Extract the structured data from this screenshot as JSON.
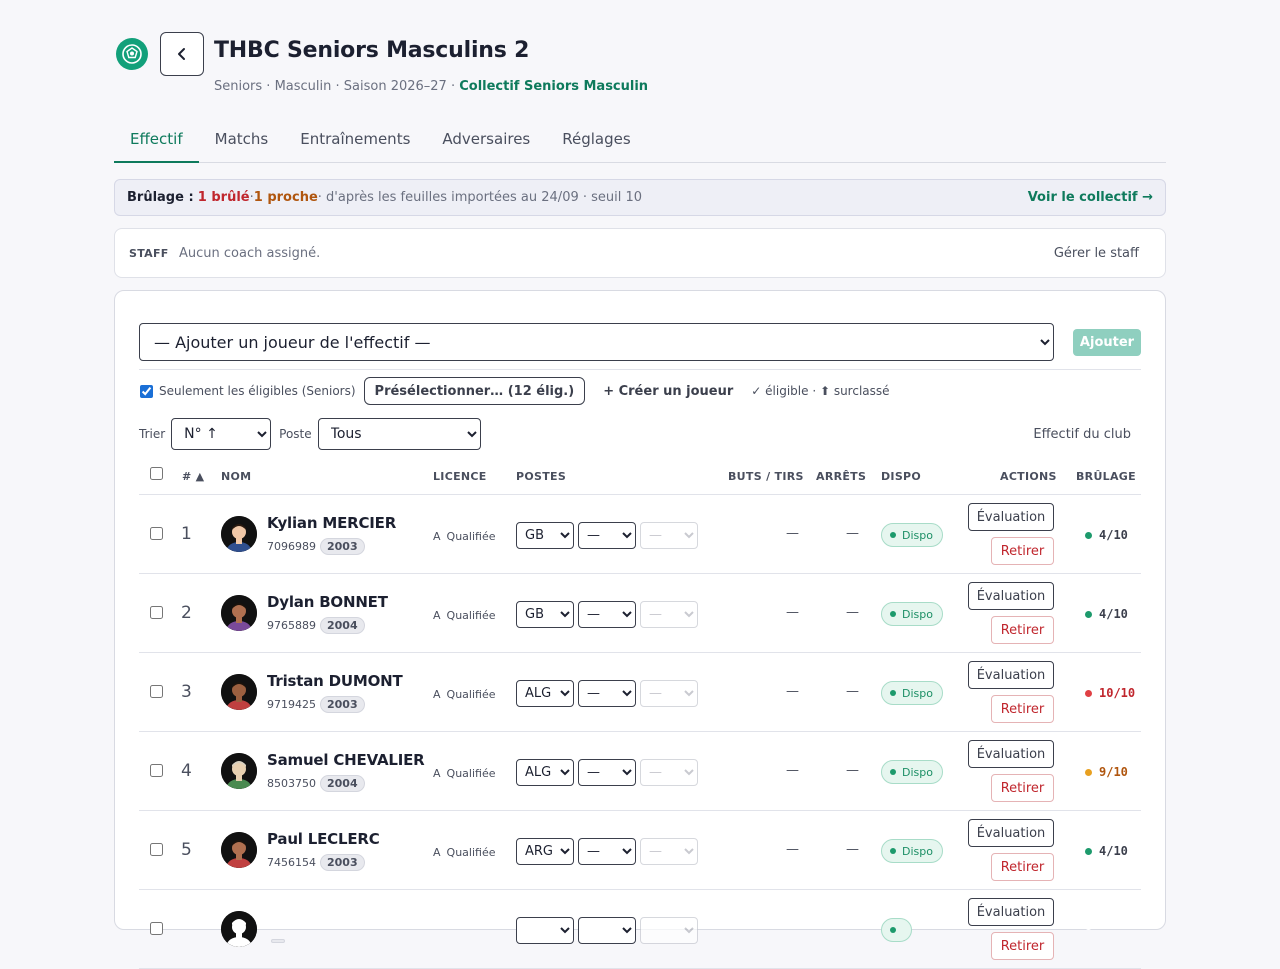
{
  "header": {
    "title": "THBC Seniors Masculins 2",
    "subtitle_meta": "Seniors · Masculin · Saison 2026–27 · ",
    "subtitle_link": "Collectif Seniors Masculin"
  },
  "tabs": [
    {
      "label": "Effectif"
    },
    {
      "label": "Matchs"
    },
    {
      "label": "Entraînements"
    },
    {
      "label": "Adversaires"
    },
    {
      "label": "Réglages"
    }
  ],
  "banner": {
    "label": "Brûlage :",
    "burnt": "1 brûlé",
    "sep": " · ",
    "close": "1 proche",
    "info": " · d'après les feuilles importées au 24/09 · seuil 10",
    "link": "Voir le collectif →"
  },
  "staff": {
    "label": "STAFF",
    "empty": "Aucun coach assigné.",
    "manage": "Gérer le staff"
  },
  "add_player": {
    "placeholder": "— Ajouter un joueur de l'effectif —",
    "button": "Ajouter"
  },
  "filters": {
    "eligible_label": "Seulement les éligibles (Seniors)",
    "eligible_checked": true,
    "preselect_button": "Présélectionner… (12 élig.)",
    "create_link": "+ Créer un joueur",
    "legend": "✓ éligible · ⬆ surclassé"
  },
  "sort": {
    "sort_label": "Trier",
    "sort_value": "N° ↑",
    "position_label": "Poste",
    "position_value": "Tous",
    "club_link": "Effectif du club"
  },
  "table": {
    "headers": {
      "num": "# ▲",
      "name": "NOM",
      "licence": "LICENCE",
      "positions": "POSTES",
      "goals": "BUTS / TIRS",
      "saves": "ARRÊTS",
      "dispo": "DISPO",
      "actions": "ACTIONS",
      "burn": "BRÛLAGE"
    },
    "eval_label": "Évaluation",
    "remove_label": "Retirer",
    "rows": [
      {
        "num": "1",
        "name": "Kylian MERCIER",
        "licence_no": "7096989",
        "year": "2003",
        "lic_type": "A",
        "lic_status": "Qualifiée",
        "pos1": "GB",
        "pos2": "—",
        "pos3": "—",
        "goals": "—",
        "saves": "—",
        "dispo": "Dispo",
        "burn": "4/10",
        "burn_color": "#1d9a6c",
        "burn_text_color": "#3b3f4c",
        "avatar_skin": "#f0c8a8",
        "avatar_shirt": "#2f4f8f",
        "avatar_hair": "#2a1a10"
      },
      {
        "num": "2",
        "name": "Dylan BONNET",
        "licence_no": "9765889",
        "year": "2004",
        "lic_type": "A",
        "lic_status": "Qualifiée",
        "pos1": "GB",
        "pos2": "—",
        "pos3": "—",
        "goals": "—",
        "saves": "—",
        "dispo": "Dispo",
        "burn": "4/10",
        "burn_color": "#1d9a6c",
        "burn_text_color": "#3b3f4c",
        "avatar_skin": "#b07050",
        "avatar_shirt": "#7a4a9a",
        "avatar_hair": "#1a120c"
      },
      {
        "num": "3",
        "name": "Tristan DUMONT",
        "licence_no": "9719425",
        "year": "2003",
        "lic_type": "A",
        "lic_status": "Qualifiée",
        "pos1": "ALG",
        "pos2": "—",
        "pos3": "—",
        "goals": "—",
        "saves": "—",
        "dispo": "Dispo",
        "burn": "10/10",
        "burn_color": "#e04044",
        "burn_text_color": "#c0262d",
        "avatar_skin": "#9c6040",
        "avatar_shirt": "#c04040",
        "avatar_hair": "#1a120c"
      },
      {
        "num": "4",
        "name": "Samuel CHEVALIER",
        "licence_no": "8503750",
        "year": "2004",
        "lic_type": "A",
        "lic_status": "Qualifiée",
        "pos1": "ALG",
        "pos2": "—",
        "pos3": "—",
        "goals": "—",
        "saves": "—",
        "dispo": "Dispo",
        "burn": "9/10",
        "burn_color": "#e8a020",
        "burn_text_color": "#b0560f",
        "avatar_skin": "#e8d0b0",
        "avatar_shirt": "#4a8a50",
        "avatar_hair": "#d8d0c0"
      },
      {
        "num": "5",
        "name": "Paul LECLERC",
        "licence_no": "7456154",
        "year": "2003",
        "lic_type": "A",
        "lic_status": "Qualifiée",
        "pos1": "ARG",
        "pos2": "—",
        "pos3": "—",
        "goals": "—",
        "saves": "—",
        "dispo": "Dispo",
        "burn": "4/10",
        "burn_color": "#1d9a6c",
        "burn_text_color": "#3b3f4c",
        "avatar_skin": "#b07050",
        "avatar_shirt": "#c04040",
        "avatar_hair": "#1a120c"
      },
      {
        "num": "",
        "name": "",
        "licence_no": "",
        "year": "",
        "lic_type": "",
        "lic_status": "",
        "pos1": "",
        "pos2": "",
        "pos3": "",
        "goals": "",
        "saves": "",
        "dispo": "",
        "burn": "",
        "burn_color": "#ffffff",
        "burn_text_color": "#3b3f4c",
        "avatar_skin": "#ffffff",
        "avatar_shirt": "#ffffff",
        "avatar_hair": "#ffffff"
      }
    ]
  }
}
